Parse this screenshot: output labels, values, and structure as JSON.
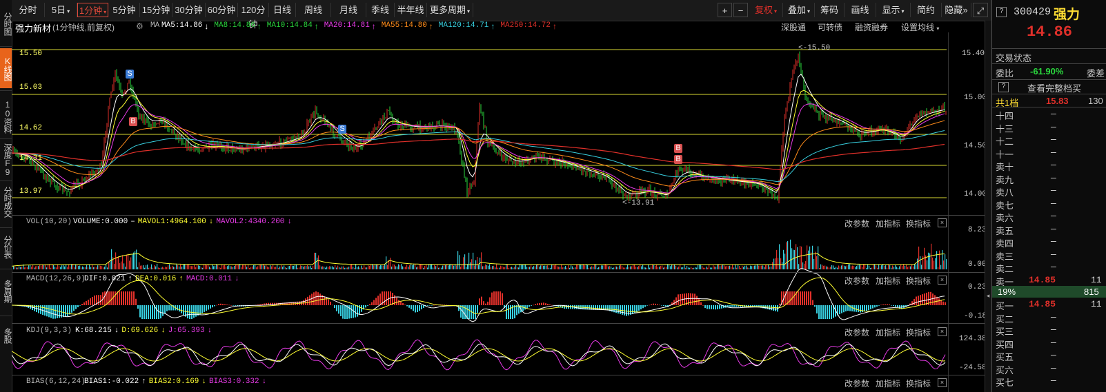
{
  "left_tabs": [
    {
      "label": "分时图"
    },
    {
      "label": "K线图",
      "active": true
    },
    {
      "label": "10资料"
    },
    {
      "label": "深度F9"
    },
    {
      "label": "分时成交"
    },
    {
      "label": "分价表"
    },
    {
      "label": "多周期"
    },
    {
      "label": "多股"
    }
  ],
  "toolbar": {
    "periods": [
      {
        "label": "分时"
      },
      {
        "label": "5日",
        "dropdown": true
      },
      {
        "label": "1分钟",
        "dropdown": true,
        "active": true
      },
      {
        "label": "5分钟"
      },
      {
        "label": "15分钟"
      },
      {
        "label": "30分钟"
      },
      {
        "label": "60分钟"
      },
      {
        "label": "120分钟"
      },
      {
        "label": "日线"
      },
      {
        "label": "周线"
      },
      {
        "label": "月线"
      },
      {
        "label": "季线"
      },
      {
        "label": "半年线"
      },
      {
        "label": "更多周期",
        "dropdown": true
      }
    ],
    "plus": "+",
    "minus": "−",
    "fuquan": "复权",
    "tools": [
      {
        "label": "叠加",
        "dropdown": true
      },
      {
        "label": "筹码"
      },
      {
        "label": "画线"
      },
      {
        "label": "显示",
        "dropdown": true
      },
      {
        "label": "简约"
      },
      {
        "label": "隐藏"
      }
    ],
    "more_icon": "»",
    "expand_icon": "⤢"
  },
  "infoline": {
    "name": "强力新材",
    "subtitle": "(1分钟线,前复权)",
    "ma_label": "MA",
    "ma": [
      {
        "text": "MA5:14.86",
        "dir": "↓",
        "color": "#ffffff",
        "dir_color": "#ffffff"
      },
      {
        "text": "MA8:14.86",
        "dir": "↑",
        "color": "#2ad63d",
        "dir_color": "#2ad63d"
      },
      {
        "text": "MA10:14.84",
        "dir": "↑",
        "color": "#2ad63d",
        "dir_color": "#2ad63d"
      },
      {
        "text": "MA20:14.81",
        "dir": "↑",
        "color": "#e83be8",
        "dir_color": "#e83be8"
      },
      {
        "text": "MA55:14.80",
        "dir": "↑",
        "color": "#ff8c1a",
        "dir_color": "#ff8c1a"
      },
      {
        "text": "MA120:14.71",
        "dir": "↑",
        "color": "#38d0e0",
        "dir_color": "#38d0e0"
      },
      {
        "text": "MA250:14.72",
        "dir": "↑",
        "color": "#e0302a",
        "dir_color": "#e0302a"
      }
    ],
    "links": [
      {
        "label": "深股通"
      },
      {
        "label": "可转债"
      },
      {
        "label": "融资融券"
      },
      {
        "label": "设置均线",
        "dropdown": true
      }
    ]
  },
  "main_chart": {
    "y_axis_labels": [
      "15.40",
      "15.00",
      "14.50",
      "14.00"
    ],
    "hlines": [
      "15.50",
      "15.03",
      "14.62",
      "14.31",
      "13.97"
    ],
    "high_annot": "15.50",
    "low_annot": "13.91",
    "markers": [
      "S",
      "S",
      "B",
      "B",
      "B"
    ]
  },
  "vol_panel": {
    "header": "VOL(10,20)",
    "items": [
      {
        "text": "VOLUME:0.000",
        "color": "#ffffff"
      },
      {
        "text": "–",
        "color": "#ffffff"
      },
      {
        "text": "MAVOL1:4964.100",
        "color": "#ffff33"
      },
      {
        "text": "↓",
        "color": "#ffff33"
      },
      {
        "text": "MAVOL2:4340.200",
        "color": "#e83be8"
      },
      {
        "text": "↓",
        "color": "#e83be8"
      }
    ],
    "y_labels": [
      "8.23",
      "0.00"
    ]
  },
  "macd_panel": {
    "header": "MACD(12,26,9)",
    "items": [
      {
        "text": "DIF:0.021",
        "color": "#ffffff"
      },
      {
        "text": "↑",
        "color": "#ffffff"
      },
      {
        "text": "DEA:0.016",
        "color": "#ffff33"
      },
      {
        "text": "↑",
        "color": "#ffff33"
      },
      {
        "text": "MACD:0.011",
        "color": "#e83be8"
      },
      {
        "text": "↓",
        "color": "#e83be8"
      }
    ],
    "y_labels": [
      "0.23",
      "-0.18"
    ]
  },
  "kdj_panel": {
    "header": "KDJ(9,3,3)",
    "items": [
      {
        "text": "K:68.215",
        "color": "#ffffff"
      },
      {
        "text": "↓",
        "color": "#ffffff"
      },
      {
        "text": "D:69.626",
        "color": "#ffff33"
      },
      {
        "text": "↓",
        "color": "#ffff33"
      },
      {
        "text": "J:65.393",
        "color": "#e83be8"
      },
      {
        "text": "↓",
        "color": "#e83be8"
      }
    ],
    "y_labels": [
      "124.38",
      "-24.58"
    ]
  },
  "bias_panel": {
    "header": "BIAS(6,12,24)",
    "items": [
      {
        "text": "BIAS1:-0.022",
        "color": "#ffffff"
      },
      {
        "text": "↑",
        "color": "#ffffff"
      },
      {
        "text": "BIAS2:0.169",
        "color": "#ffff33"
      },
      {
        "text": "↓",
        "color": "#ffff33"
      },
      {
        "text": "BIAS3:0.332",
        "color": "#e83be8"
      },
      {
        "text": "↓",
        "color": "#e83be8"
      }
    ]
  },
  "panel_buttons": {
    "params": "改参数",
    "add": "加指标",
    "switch": "换指标",
    "close": "×"
  },
  "right_panel": {
    "code": "300429",
    "name": "强力",
    "price": "14.86",
    "trade_status": "交易状态",
    "ratio_label": "委比",
    "ratio_value": "-61.90%",
    "ratio_right": "委差",
    "view_full": "查看完整档买",
    "help": "?",
    "level1_label": "共1档",
    "level1_price": "15.83",
    "level1_vol": "130",
    "asks": [
      {
        "label": "十四",
        "price": "—",
        "vol": "—"
      },
      {
        "label": "十三",
        "price": "—",
        "vol": "—"
      },
      {
        "label": "十二",
        "price": "—",
        "vol": "—"
      },
      {
        "label": "十一",
        "price": "—",
        "vol": "—"
      },
      {
        "label": "卖十",
        "price": "—",
        "vol": "—"
      },
      {
        "label": "卖九",
        "price": "—",
        "vol": "—"
      },
      {
        "label": "卖八",
        "price": "—",
        "vol": "—"
      },
      {
        "label": "卖七",
        "price": "—",
        "vol": "—"
      },
      {
        "label": "卖六",
        "price": "—",
        "vol": "—"
      },
      {
        "label": "卖五",
        "price": "—",
        "vol": "—"
      },
      {
        "label": "卖四",
        "price": "—",
        "vol": "—"
      },
      {
        "label": "卖三",
        "price": "—",
        "vol": "—"
      },
      {
        "label": "卖二",
        "price": "—",
        "vol": "—"
      },
      {
        "label": "卖一",
        "price": "14.85",
        "vol": "11"
      }
    ],
    "mid_pct": "19%",
    "mid_vol": "815",
    "bids": [
      {
        "label": "买一",
        "price": "14.85",
        "vol": "11"
      },
      {
        "label": "买二",
        "price": "—",
        "vol": "—"
      },
      {
        "label": "买三",
        "price": "—",
        "vol": "—"
      },
      {
        "label": "买四",
        "price": "—",
        "vol": "—"
      },
      {
        "label": "买五",
        "price": "—",
        "vol": "—"
      },
      {
        "label": "买六",
        "price": "—",
        "vol": "—"
      },
      {
        "label": "买七",
        "price": "—",
        "vol": "—"
      }
    ],
    "grip": "◂"
  },
  "colors": {
    "up": "#e0302a",
    "down": "#2ad63d",
    "accent": "#e8641b",
    "yellow": "#ffff33",
    "cyan": "#38d0e0",
    "magenta": "#e83be8",
    "orange": "#ff8c1a",
    "white": "#ffffff"
  }
}
